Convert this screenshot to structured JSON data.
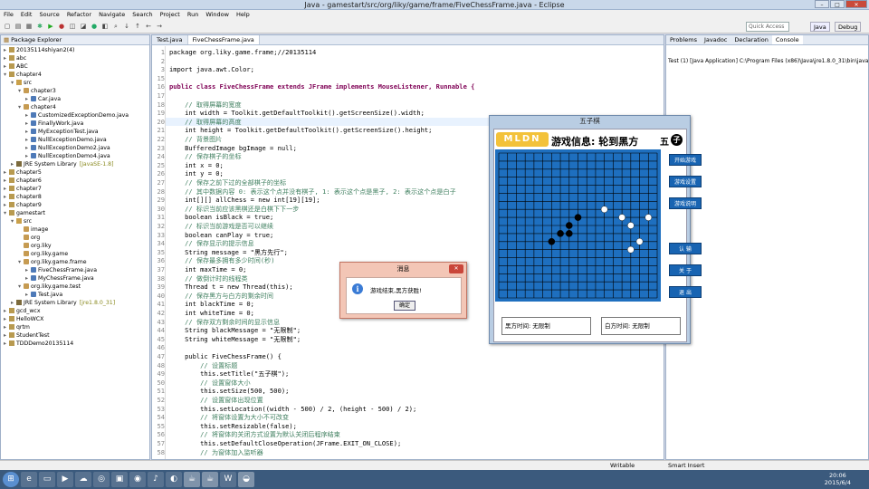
{
  "window": {
    "title": "Java - gamestart/src/org/liky/game/frame/FiveChessFrame.java - Eclipse"
  },
  "menu": [
    "File",
    "Edit",
    "Source",
    "Refactor",
    "Navigate",
    "Search",
    "Project",
    "Run",
    "Window",
    "Help"
  ],
  "quick_access": "Quick Access",
  "perspectives": {
    "java": "Java",
    "debug": "Debug"
  },
  "package_explorer": {
    "title": "Package Explorer",
    "items": [
      {
        "indent": 0,
        "twisty": "▸",
        "icon": "prj",
        "label": "20135114shiyan2(4)"
      },
      {
        "indent": 0,
        "twisty": "▸",
        "icon": "prj",
        "label": "abc"
      },
      {
        "indent": 0,
        "twisty": "▸",
        "icon": "prj",
        "label": "ABC"
      },
      {
        "indent": 0,
        "twisty": "▾",
        "icon": "prj",
        "label": "chapter4"
      },
      {
        "indent": 1,
        "twisty": "▾",
        "icon": "src",
        "label": "src"
      },
      {
        "indent": 2,
        "twisty": "▾",
        "icon": "pkg",
        "label": "chapter3"
      },
      {
        "indent": 3,
        "twisty": "▸",
        "icon": "jv",
        "label": "Car.java"
      },
      {
        "indent": 2,
        "twisty": "▾",
        "icon": "pkg",
        "label": "chapter4"
      },
      {
        "indent": 3,
        "twisty": "▸",
        "icon": "jv",
        "label": "CustomizedExceptionDemo.java"
      },
      {
        "indent": 3,
        "twisty": "▸",
        "icon": "jv",
        "label": "FinallyWork.java"
      },
      {
        "indent": 3,
        "twisty": "▸",
        "icon": "jv",
        "label": "MyExceptionTest.java"
      },
      {
        "indent": 3,
        "twisty": "▸",
        "icon": "jv",
        "label": "NullExceptionDemo.java"
      },
      {
        "indent": 3,
        "twisty": "▸",
        "icon": "jv",
        "label": "NullExceptionDemo2.java"
      },
      {
        "indent": 3,
        "twisty": "▸",
        "icon": "jv",
        "label": "NullExceptionDemo4.java"
      },
      {
        "indent": 1,
        "twisty": "▸",
        "icon": "jr",
        "label": "JRE System Library",
        "suffix": "[JavaSE-1.8]"
      },
      {
        "indent": 0,
        "twisty": "▸",
        "icon": "prj",
        "label": "chapter5"
      },
      {
        "indent": 0,
        "twisty": "▸",
        "icon": "prj",
        "label": "chapter6"
      },
      {
        "indent": 0,
        "twisty": "▸",
        "icon": "prj",
        "label": "chapter7"
      },
      {
        "indent": 0,
        "twisty": "▸",
        "icon": "prj",
        "label": "chapter8"
      },
      {
        "indent": 0,
        "twisty": "▸",
        "icon": "prj",
        "label": "chapter9"
      },
      {
        "indent": 0,
        "twisty": "▾",
        "icon": "prj",
        "label": "gamestart"
      },
      {
        "indent": 1,
        "twisty": "▾",
        "icon": "src",
        "label": "src"
      },
      {
        "indent": 2,
        "twisty": "",
        "icon": "pkg",
        "label": "image"
      },
      {
        "indent": 2,
        "twisty": "",
        "icon": "pkg",
        "label": "org"
      },
      {
        "indent": 2,
        "twisty": "",
        "icon": "pkg",
        "label": "org.liky"
      },
      {
        "indent": 2,
        "twisty": "",
        "icon": "pkg",
        "label": "org.liky.game"
      },
      {
        "indent": 2,
        "twisty": "▾",
        "icon": "pkg",
        "label": "org.liky.game.frame"
      },
      {
        "indent": 3,
        "twisty": "▸",
        "icon": "jv",
        "label": "FiveChessFrame.java"
      },
      {
        "indent": 3,
        "twisty": "▸",
        "icon": "jv",
        "label": "MyChessFrame.java"
      },
      {
        "indent": 2,
        "twisty": "▾",
        "icon": "pkg",
        "label": "org.liky.game.test"
      },
      {
        "indent": 3,
        "twisty": "▸",
        "icon": "jv",
        "label": "Test.java"
      },
      {
        "indent": 1,
        "twisty": "▸",
        "icon": "jr",
        "label": "JRE System Library",
        "suffix": "[jre1.8.0_31]"
      },
      {
        "indent": 0,
        "twisty": "▸",
        "icon": "prj",
        "label": "gcd_wcx"
      },
      {
        "indent": 0,
        "twisty": "▸",
        "icon": "prj",
        "label": "HelloWCX"
      },
      {
        "indent": 0,
        "twisty": "▸",
        "icon": "prj",
        "label": "qrtm"
      },
      {
        "indent": 0,
        "twisty": "▸",
        "icon": "prj",
        "label": "StudentTest"
      },
      {
        "indent": 0,
        "twisty": "▸",
        "icon": "prj",
        "label": "TDDDemo20135114"
      }
    ]
  },
  "editor": {
    "tabs": [
      "Test.java",
      "FiveChessFrame.java"
    ],
    "lines": [
      {
        "n": "1",
        "t": "package org.liky.game.frame;//20135114",
        "k": ""
      },
      {
        "n": "2",
        "t": "",
        "k": ""
      },
      {
        "n": "3",
        "t": "import java.awt.Color;",
        "k": ""
      },
      {
        "n": "15",
        "t": "",
        "k": ""
      },
      {
        "n": "16",
        "t": "public class FiveChessFrame extends JFrame implements MouseListener, Runnable {",
        "k": "kw"
      },
      {
        "n": "17",
        "t": "",
        "k": ""
      },
      {
        "n": "18",
        "t": "    // 取得屏幕的宽度",
        "k": "cm"
      },
      {
        "n": "19",
        "t": "    int width = Toolkit.getDefaultToolkit().getScreenSize().width;",
        "k": ""
      },
      {
        "n": "20",
        "t": "    // 取得屏幕的高度",
        "k": "cm"
      },
      {
        "n": "21",
        "t": "    int height = Toolkit.getDefaultToolkit().getScreenSize().height;",
        "k": ""
      },
      {
        "n": "22",
        "t": "    // 背景图片",
        "k": "cm"
      },
      {
        "n": "23",
        "t": "    BufferedImage bgImage = null;",
        "k": ""
      },
      {
        "n": "24",
        "t": "    // 保存棋子的坐标",
        "k": "cm"
      },
      {
        "n": "25",
        "t": "    int x = 0;",
        "k": ""
      },
      {
        "n": "26",
        "t": "    int y = 0;",
        "k": ""
      },
      {
        "n": "27",
        "t": "    // 保存之前下过的全部棋子的坐标",
        "k": "cm"
      },
      {
        "n": "28",
        "t": "    // 其中数据内容 0: 表示这个点并没有棋子, 1: 表示这个点是黑子, 2: 表示这个点是白子",
        "k": "cm"
      },
      {
        "n": "29",
        "t": "    int[][] allChess = new int[19][19];",
        "k": ""
      },
      {
        "n": "30",
        "t": "    // 标识当前应该黑棋还是白棋下下一步",
        "k": "cm"
      },
      {
        "n": "31",
        "t": "    boolean isBlack = true;",
        "k": ""
      },
      {
        "n": "32",
        "t": "    // 标识当前游戏是否可以继续",
        "k": "cm"
      },
      {
        "n": "33",
        "t": "    boolean canPlay = true;",
        "k": ""
      },
      {
        "n": "34",
        "t": "    // 保存显示的提示信息",
        "k": "cm"
      },
      {
        "n": "35",
        "t": "    String message = \"黑方先行\";",
        "k": ""
      },
      {
        "n": "36",
        "t": "    // 保存最多拥有多少时间(秒)",
        "k": "cm"
      },
      {
        "n": "37",
        "t": "    int maxTime = 0;",
        "k": ""
      },
      {
        "n": "38",
        "t": "    // 做倒计时的线程类",
        "k": "cm"
      },
      {
        "n": "39",
        "t": "    Thread t = new Thread(this);",
        "k": ""
      },
      {
        "n": "40",
        "t": "    // 保存黑方与白方的剩余时间",
        "k": "cm"
      },
      {
        "n": "41",
        "t": "    int blackTime = 0;",
        "k": ""
      },
      {
        "n": "42",
        "t": "    int whiteTime = 0;",
        "k": ""
      },
      {
        "n": "43",
        "t": "    // 保存双方剩余时间的显示信息",
        "k": "cm"
      },
      {
        "n": "44",
        "t": "    String blackMessage = \"无限制\";",
        "k": ""
      },
      {
        "n": "45",
        "t": "    String whiteMessage = \"无限制\";",
        "k": ""
      },
      {
        "n": "46",
        "t": "",
        "k": ""
      },
      {
        "n": "47",
        "t": "    public FiveChessFrame() {",
        "k": ""
      },
      {
        "n": "48",
        "t": "        // 设置标题",
        "k": "cm"
      },
      {
        "n": "49",
        "t": "        this.setTitle(\"五子棋\");",
        "k": ""
      },
      {
        "n": "50",
        "t": "        // 设置窗体大小",
        "k": "cm"
      },
      {
        "n": "51",
        "t": "        this.setSize(500, 500);",
        "k": ""
      },
      {
        "n": "52",
        "t": "        // 设置窗体出现位置",
        "k": "cm"
      },
      {
        "n": "53",
        "t": "        this.setLocation((width - 500) / 2, (height - 500) / 2);",
        "k": ""
      },
      {
        "n": "54",
        "t": "        // 将窗体设置为大小不可改变",
        "k": "cm"
      },
      {
        "n": "55",
        "t": "        this.setResizable(false);",
        "k": ""
      },
      {
        "n": "56",
        "t": "        // 将窗体的关闭方式设置为默认关闭后程序结束",
        "k": "cm"
      },
      {
        "n": "57",
        "t": "        this.setDefaultCloseOperation(JFrame.EXIT_ON_CLOSE);",
        "k": ""
      },
      {
        "n": "58",
        "t": "        // 为窗体加入监听器",
        "k": "cm"
      }
    ]
  },
  "console": {
    "tabs": [
      "Problems",
      "Javadoc",
      "Declaration",
      "Console"
    ],
    "text": "Test (1) [Java Application] C:\\Program Files (x86)\\Java\\jre1.8.0_31\\bin\\javaw.exe"
  },
  "status": {
    "mode": "Writable",
    "mode2": "Smart Insert"
  },
  "game": {
    "title": "五子棋",
    "logo": "MLDN",
    "info": "游戏信息: 轮到黑方",
    "wuzi": [
      "五",
      "子"
    ],
    "buttons": [
      "开始游戏",
      "游戏设置",
      "游戏说明",
      "认  输",
      "关  于",
      "退  出"
    ],
    "black_time": "黑方时间: 无限制",
    "white_time": "白方时间: 无限制",
    "stones": [
      {
        "c": 6,
        "r": 11,
        "color": "black"
      },
      {
        "c": 7,
        "r": 10,
        "color": "black"
      },
      {
        "c": 8,
        "r": 10,
        "color": "black"
      },
      {
        "c": 8,
        "r": 9,
        "color": "black"
      },
      {
        "c": 9,
        "r": 8,
        "color": "black"
      },
      {
        "c": 12,
        "r": 7,
        "color": "white"
      },
      {
        "c": 14,
        "r": 8,
        "color": "white"
      },
      {
        "c": 15,
        "r": 9,
        "color": "white"
      },
      {
        "c": 16,
        "r": 11,
        "color": "white"
      },
      {
        "c": 15,
        "r": 12,
        "color": "white"
      },
      {
        "c": 17,
        "r": 8,
        "color": "white"
      }
    ]
  },
  "dialog": {
    "title": "消息",
    "message": "游戏结束,黑方获胜!",
    "ok": "确定",
    "info_glyph": "i"
  },
  "clock": {
    "time": "20:06",
    "date": "2015/6/4"
  }
}
